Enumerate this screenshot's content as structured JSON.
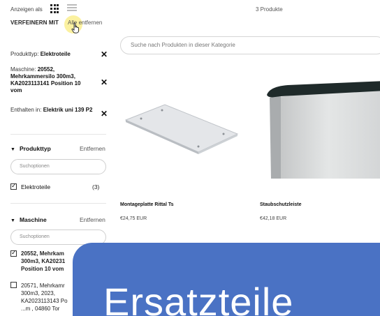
{
  "toolbar": {
    "view_label": "Anzeigen als",
    "product_count": "3 Produkte"
  },
  "sidebar": {
    "refine_heading": "VERFEINERN MIT",
    "remove_all": "Alle entfernen",
    "active_filters": [
      {
        "prefix": "Produkttyp: ",
        "value": "Elektroteile"
      },
      {
        "prefix": "Maschine: ",
        "value": "20552, Mehrkammersilo 300m3, KA2023113141 Position 10 vom"
      },
      {
        "prefix": "Enthalten in: ",
        "value": "Elektrik uni 139 P2"
      }
    ],
    "facet_product_type": {
      "heading": "Produkttyp",
      "remove": "Entfernen",
      "search_placeholder": "Suchoptionen",
      "options": [
        {
          "label": "Elektroteile",
          "count": "(3)",
          "checked": true
        }
      ]
    },
    "facet_machine": {
      "heading": "Maschine",
      "remove": "Entfernen",
      "search_placeholder": "Suchoptionen",
      "options": [
        {
          "label": "20552, Mehrkam 300m3, KA20231 Position 10 vom",
          "checked": true
        },
        {
          "label": "20571, Mehrkamr 300m3, 2023, KA2023113143 Po ...m , 04860 Tor",
          "checked": false
        }
      ]
    }
  },
  "main": {
    "search_placeholder": "Suche nach Produkten in dieser Kategorie",
    "products": [
      {
        "name": "Montageplatte Rittal Ts",
        "price": "€24,75 EUR"
      },
      {
        "name": "Staubschutzleiste",
        "price": "€42,18 EUR"
      }
    ]
  },
  "overlay": {
    "title": "Ersatzteile"
  },
  "colors": {
    "banner": "#4a72c4",
    "highlight": "#f5e56b"
  }
}
